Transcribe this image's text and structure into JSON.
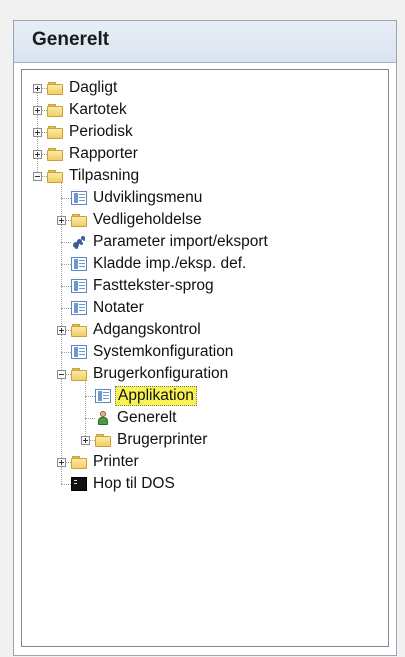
{
  "panel": {
    "title": "Generelt"
  },
  "tree": {
    "items": [
      {
        "label": "Dagligt",
        "icon": "folder-icon",
        "expander": "plus",
        "level": 0
      },
      {
        "label": "Kartotek",
        "icon": "folder-icon",
        "expander": "plus",
        "level": 0
      },
      {
        "label": "Periodisk",
        "icon": "folder-icon",
        "expander": "plus",
        "level": 0
      },
      {
        "label": "Rapporter",
        "icon": "folder-icon",
        "expander": "plus",
        "level": 0
      },
      {
        "label": "Tilpasning",
        "icon": "folder-icon",
        "expander": "minus",
        "level": 0
      },
      {
        "label": "Udviklingsmenu",
        "icon": "form-icon",
        "expander": "none",
        "level": 1
      },
      {
        "label": "Vedligeholdelse",
        "icon": "folder-icon",
        "expander": "plus",
        "level": 1
      },
      {
        "label": "Parameter import/eksport",
        "icon": "gear-icon",
        "expander": "none",
        "level": 1
      },
      {
        "label": "Kladde imp./eksp. def.",
        "icon": "form-icon",
        "expander": "none",
        "level": 1
      },
      {
        "label": "Fasttekster-sprog",
        "icon": "form-icon",
        "expander": "none",
        "level": 1
      },
      {
        "label": "Notater",
        "icon": "form-icon",
        "expander": "none",
        "level": 1
      },
      {
        "label": "Adgangskontrol",
        "icon": "folder-icon",
        "expander": "plus",
        "level": 1
      },
      {
        "label": "Systemkonfiguration",
        "icon": "form-icon",
        "expander": "none",
        "level": 1
      },
      {
        "label": "Brugerkonfiguration",
        "icon": "folder-icon",
        "expander": "minus",
        "level": 1
      },
      {
        "label": "Applikation",
        "icon": "form-icon",
        "expander": "none",
        "level": 2,
        "selected": true
      },
      {
        "label": "Generelt",
        "icon": "user-icon",
        "expander": "none",
        "level": 2
      },
      {
        "label": "Brugerprinter",
        "icon": "folder-icon",
        "expander": "plus",
        "level": 2
      },
      {
        "label": "Printer",
        "icon": "folder-icon",
        "expander": "plus",
        "level": 1
      },
      {
        "label": "Hop til DOS",
        "icon": "terminal-icon",
        "expander": "none",
        "level": 1
      }
    ]
  },
  "colors": {
    "selection_highlight": "#f7f354",
    "folder": "#f1cf68",
    "header_bg": "#dfe7f2"
  }
}
